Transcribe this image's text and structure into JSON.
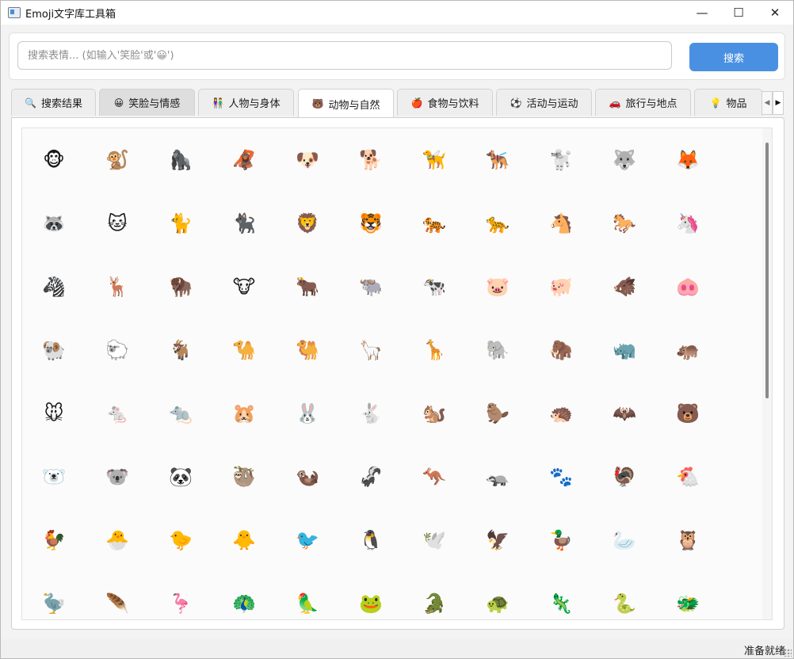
{
  "window": {
    "title": "Emoji文字库工具箱",
    "controls": {
      "minimize": "—",
      "maximize": "☐",
      "close": "✕"
    }
  },
  "search": {
    "placeholder": "搜索表情... (如输入'笑脸'或'😀')",
    "value": "",
    "button_label": "搜索"
  },
  "tabs": [
    {
      "icon": "🔍",
      "label": "搜索结果"
    },
    {
      "icon": "😀",
      "label": "笑脸与情感"
    },
    {
      "icon": "👫",
      "label": "人物与身体"
    },
    {
      "icon": "🐻",
      "label": "动物与自然"
    },
    {
      "icon": "🍎",
      "label": "食物与饮料"
    },
    {
      "icon": "⚽",
      "label": "活动与运动"
    },
    {
      "icon": "🚗",
      "label": "旅行与地点"
    },
    {
      "icon": "💡",
      "label": "物品"
    }
  ],
  "active_tab": "动物与自然",
  "tab_scroll": {
    "left": "◀",
    "right": "▶"
  },
  "emojis": [
    "🐵",
    "🐒",
    "🦍",
    "🦧",
    "🐶",
    "🐕",
    "🦮",
    "🐕‍🦺",
    "🐩",
    "🐺",
    "🦊",
    "🦝",
    "🐱",
    "🐈",
    "🐈‍⬛",
    "🦁",
    "🐯",
    "🐅",
    "🐆",
    "🐴",
    "🐎",
    "🦄",
    "🦓",
    "🦌",
    "🦬",
    "🐮",
    "🐂",
    "🐃",
    "🐄",
    "🐷",
    "🐖",
    "🐗",
    "🐽",
    "🐏",
    "🐑",
    "🐐",
    "🐪",
    "🐫",
    "🦙",
    "🦒",
    "🐘",
    "🦣",
    "🦏",
    "🦛",
    "🐭",
    "🐁",
    "🐀",
    "🐹",
    "🐰",
    "🐇",
    "🐿️",
    "🦫",
    "🦔",
    "🦇",
    "🐻",
    "🐻‍❄️",
    "🐨",
    "🐼",
    "🦥",
    "🦦",
    "🦨",
    "🦘",
    "🦡",
    "🐾",
    "🦃",
    "🐔",
    "🐓",
    "🐣",
    "🐤",
    "🐥",
    "🐦",
    "🐧",
    "🕊️",
    "🦅",
    "🦆",
    "🦢",
    "🦉",
    "🦤",
    "🪶",
    "🦩",
    "🦚",
    "🦜",
    "🐸",
    "🐊",
    "🐢",
    "🦎",
    "🐍",
    "🐲"
  ],
  "status": "准备就绪"
}
